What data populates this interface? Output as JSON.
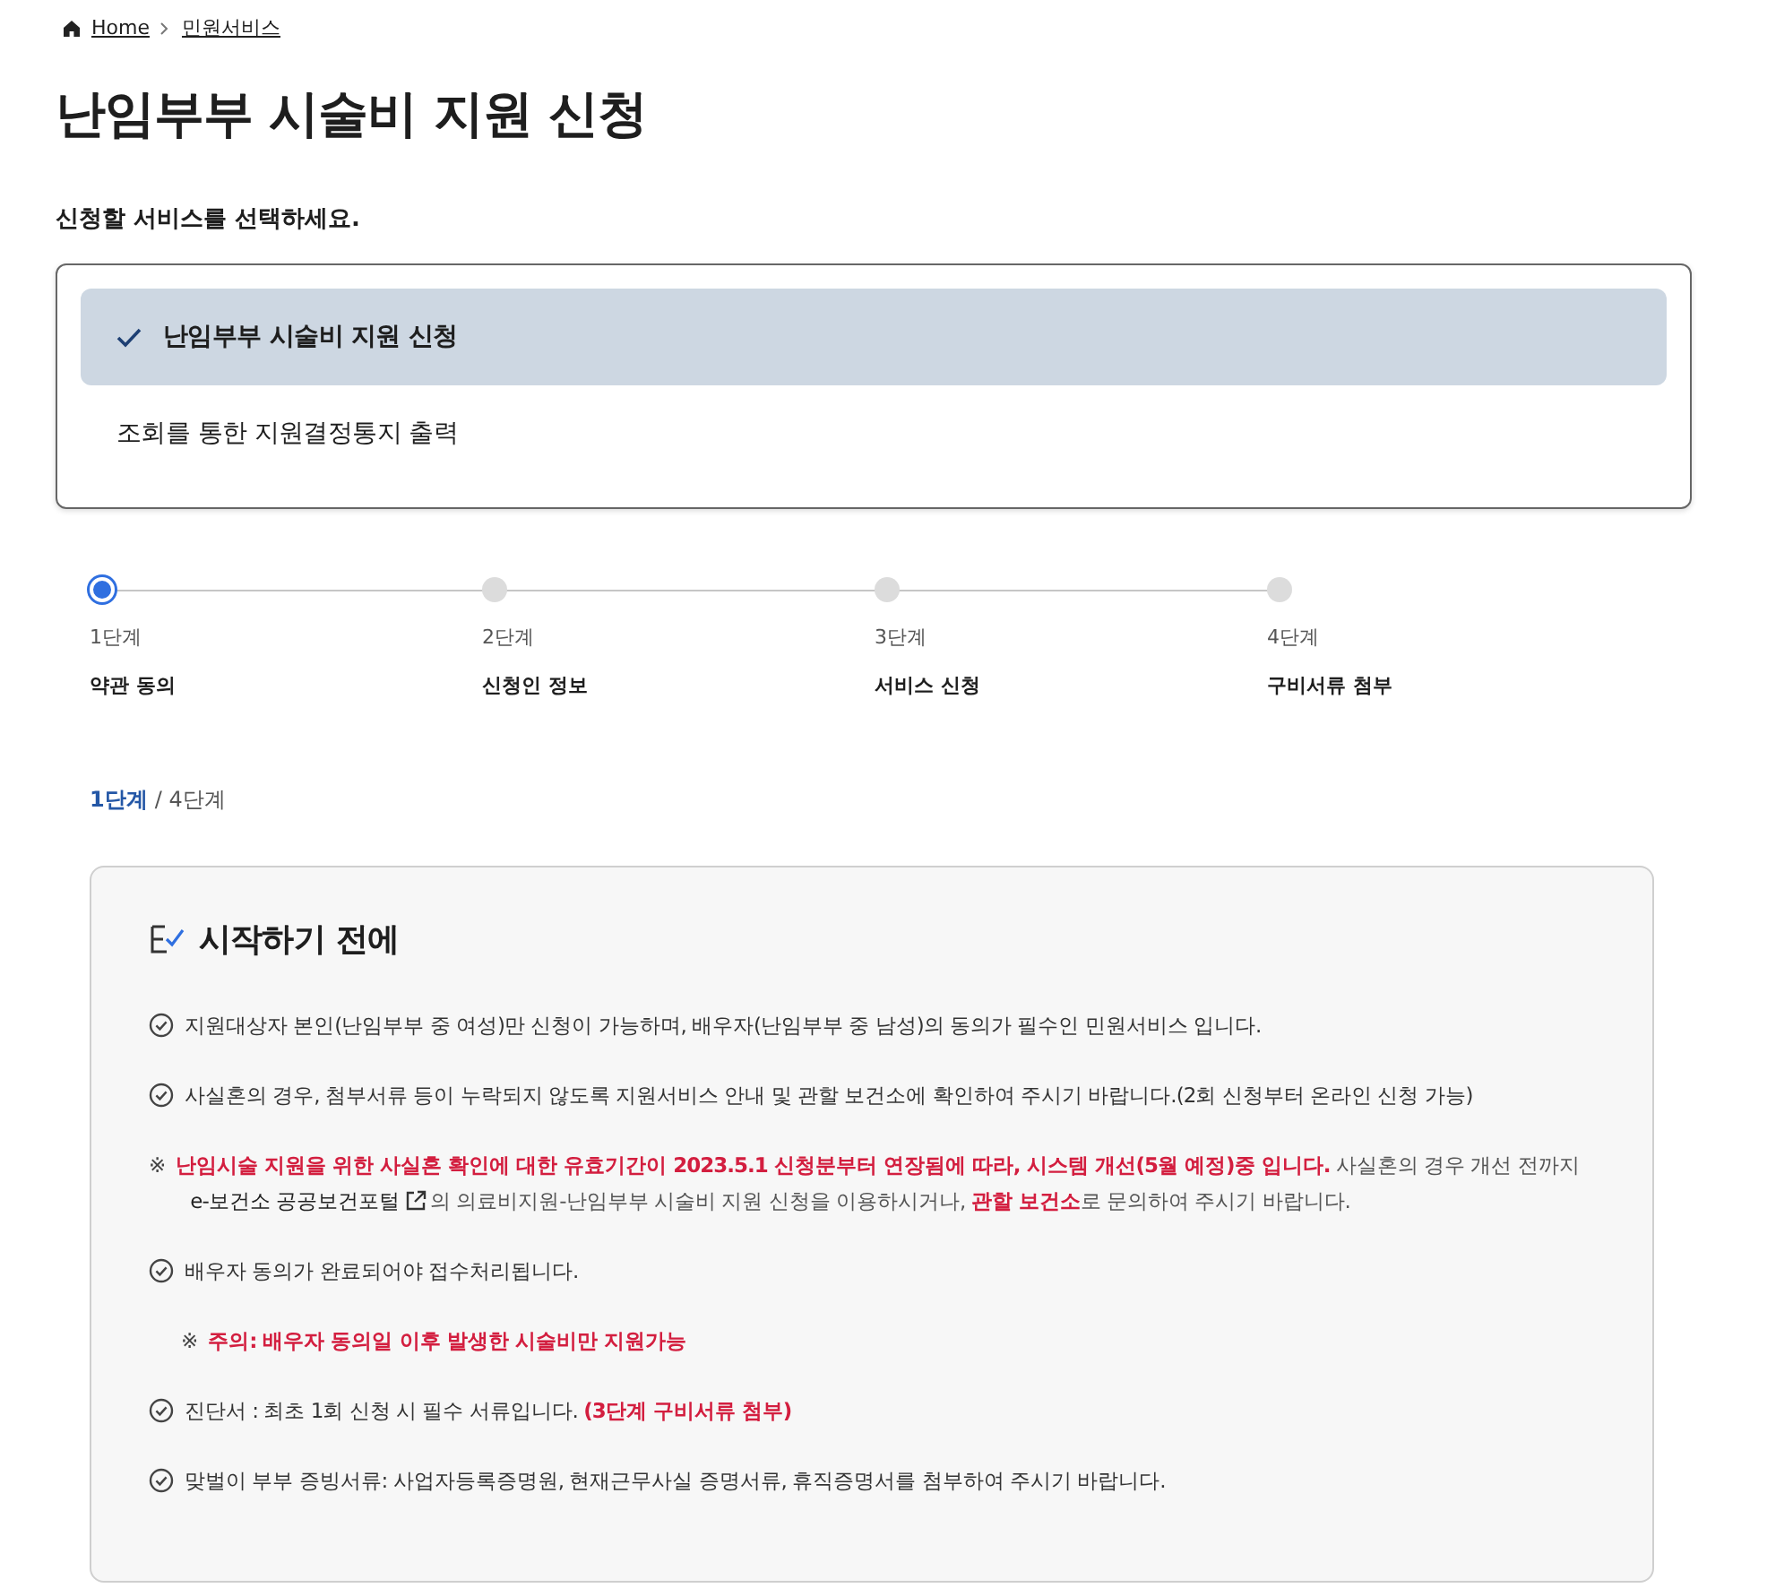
{
  "breadcrumb": [
    {
      "label": "Home"
    },
    {
      "label": "민원서비스"
    }
  ],
  "title": "난임부부 시술비 지원 신청",
  "service_prompt": "신청할 서비스를 선택하세요.",
  "services": [
    {
      "label": "난임부부 시술비 지원 신청",
      "selected": true
    },
    {
      "label": "조회를 통한 지원결정통지 출력",
      "selected": false
    }
  ],
  "steps": [
    {
      "number": "1단계",
      "label": "약관 동의",
      "selected": true
    },
    {
      "number": "2단계",
      "label": "신청인 정보",
      "selected": false
    },
    {
      "number": "3단계",
      "label": "서비스 신청",
      "selected": false
    },
    {
      "number": "4단계",
      "label": "구비서류 첨부",
      "selected": false
    }
  ],
  "progress": {
    "current": "1단계",
    "total": "/ 4단계"
  },
  "notice": {
    "title": "시작하기 전에",
    "items": [
      {
        "kind": "check",
        "text": "지원대상자 본인(난임부부 중 여성)만 신청이 가능하며, 배우자(난임부부 중 남성)의 동의가 필수인 민원서비스 입니다."
      },
      {
        "kind": "check",
        "text": "사실혼의 경우, 첨부서류 등이 누락되지 않도록 지원서비스 안내 및 관할 보건소에 확인하여 주시기 바랍니다.(2회 신청부터 온라인 신청 가능)"
      },
      {
        "kind": "note",
        "mark": "※",
        "text": "**난임시술 지원을 위한 사실혼 확인에 대한 유효기간이 2023.5.1 신청분부터 연장됨에 따라, 시스템 개선(5월 예정)중 입니다.** 사실혼의 경우 개선 전까지",
        "link": "e-보건소 공공보건포털",
        "after": "의 의료비지원-난임부부 시술비 지원 신청을 이용하시거나, **관할 보건소**로 문의하여 주시기 바랍니다."
      },
      {
        "kind": "check",
        "text": "배우자 동의가 완료되어야 접수처리됩니다."
      },
      {
        "kind": "warning",
        "mark": "※",
        "text": "**주의: 배우자 동의일 이후 발생한 시술비만 지원가능**"
      },
      {
        "kind": "check",
        "text": "진단서 : 최초 1회 신청 시 필수 서류입니다. **(3단계 구비서류 첨부)**"
      },
      {
        "kind": "check",
        "text": "맞벌이 부부 증빙서류: 사업자등록증명원, 현재근무사실 증명서류, 휴직증명서를 첨부하여 주시기 바랍니다."
      }
    ]
  }
}
